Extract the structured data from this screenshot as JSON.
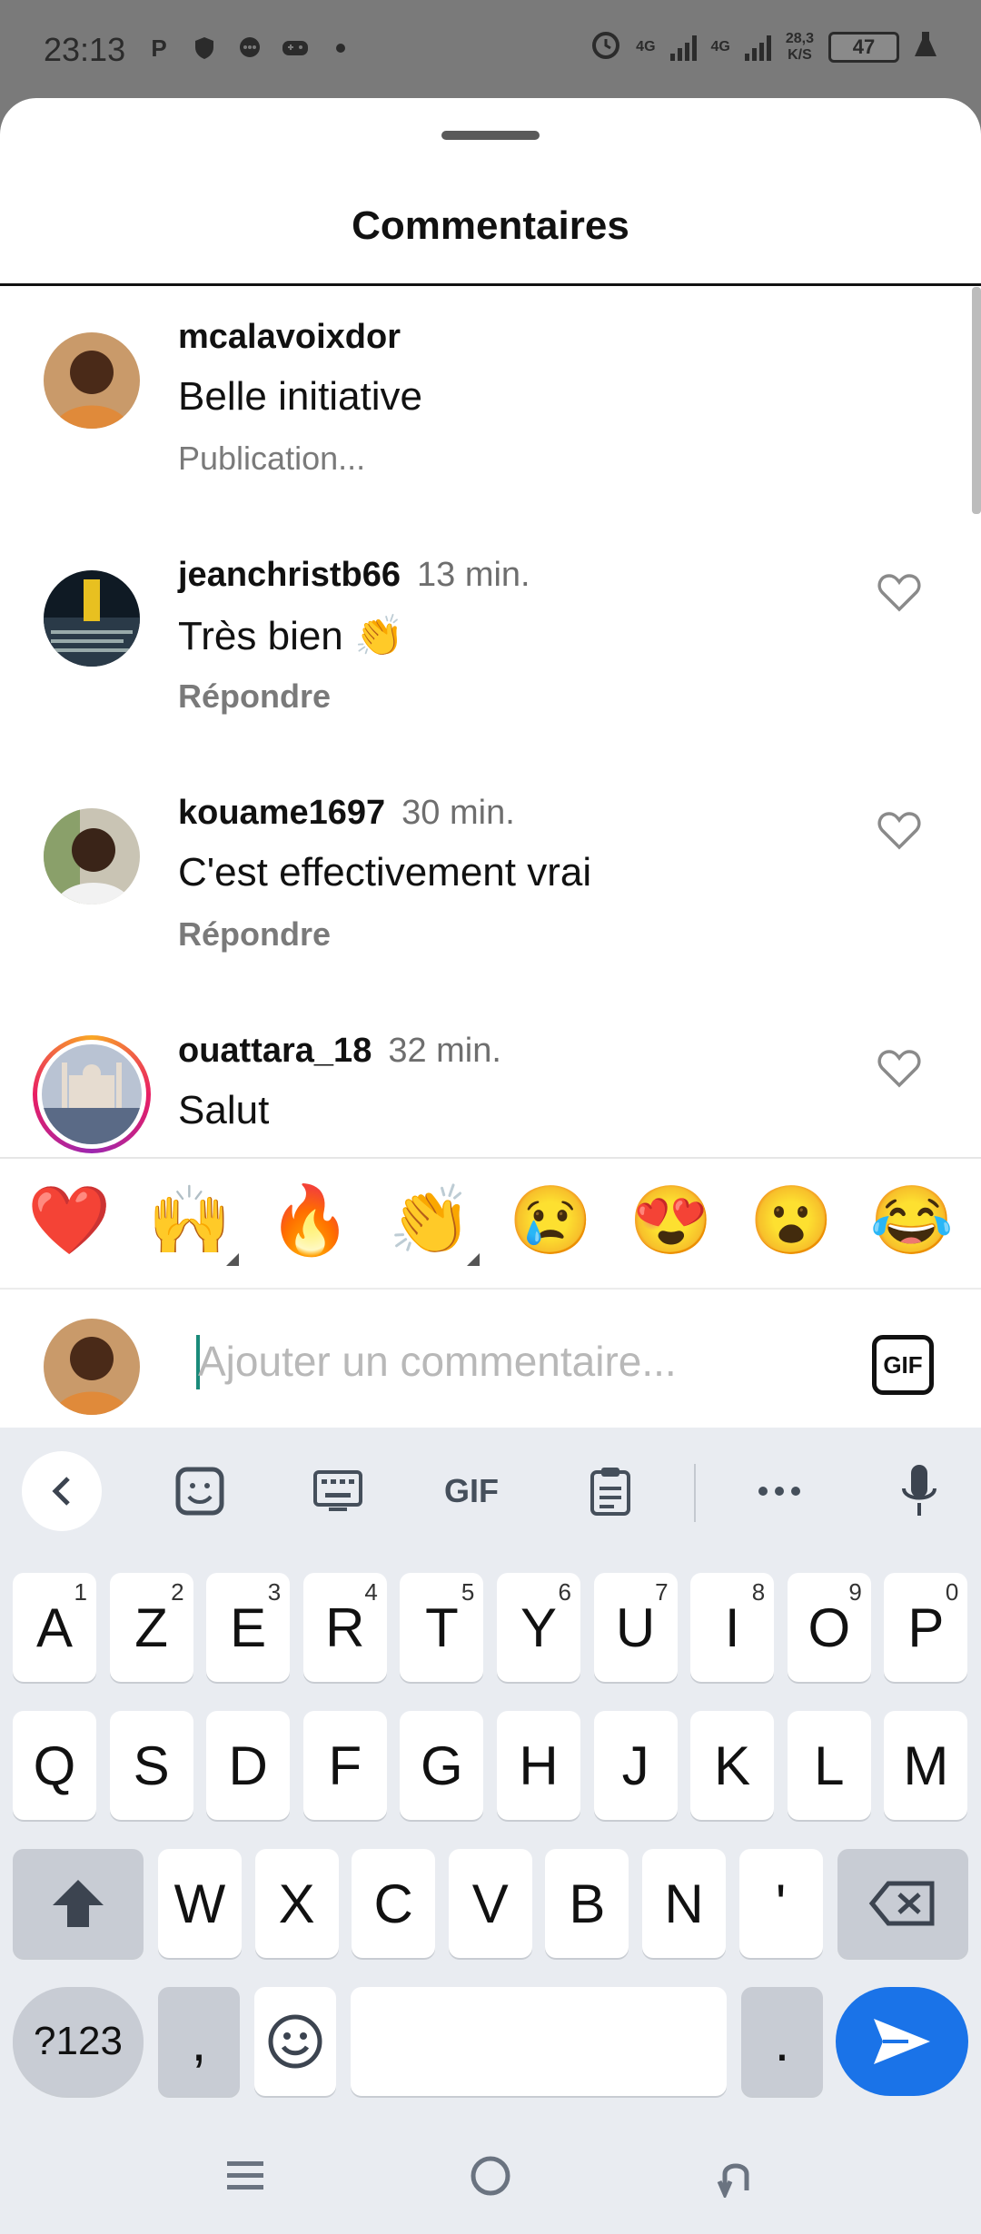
{
  "status_bar": {
    "time": "23:13",
    "left_icons": [
      "p-icon",
      "shield-icon",
      "chat-bubble-icon",
      "gamepad-icon",
      "dot-icon"
    ],
    "network_1": "4G",
    "network_2": "4G",
    "speed_value": "28,3",
    "speed_unit": "K/S",
    "battery": "47"
  },
  "sheet": {
    "title": "Commentaires"
  },
  "comments": [
    {
      "username": "mcalavoixdor",
      "time": "",
      "text": "Belle initiative",
      "meta": "Publication...",
      "liked": false,
      "has_heart": false
    },
    {
      "username": "jeanchristb66",
      "time": "13 min.",
      "text": "Très bien 👏",
      "meta": "Répondre",
      "has_heart": true
    },
    {
      "username": "kouame1697",
      "time": "30 min.",
      "text": "C'est effectivement vrai",
      "meta": "Répondre",
      "has_heart": true
    },
    {
      "username": "ouattara_18",
      "time": "32 min.",
      "text": "Salut",
      "meta": "",
      "has_heart": true
    }
  ],
  "quick_emojis": [
    "❤️",
    "🙌",
    "🔥",
    "👏",
    "😢",
    "😍",
    "😮",
    "😂"
  ],
  "input": {
    "placeholder": "Ajouter un commentaire...",
    "value": "",
    "gif_label": "GIF"
  },
  "keyboard": {
    "toolbar": {
      "gif_label": "GIF"
    },
    "row1": [
      {
        "key": "A",
        "hint": "1"
      },
      {
        "key": "Z",
        "hint": "2"
      },
      {
        "key": "E",
        "hint": "3"
      },
      {
        "key": "R",
        "hint": "4"
      },
      {
        "key": "T",
        "hint": "5"
      },
      {
        "key": "Y",
        "hint": "6"
      },
      {
        "key": "U",
        "hint": "7"
      },
      {
        "key": "I",
        "hint": "8"
      },
      {
        "key": "O",
        "hint": "9"
      },
      {
        "key": "P",
        "hint": "0"
      }
    ],
    "row2": [
      "Q",
      "S",
      "D",
      "F",
      "G",
      "H",
      "J",
      "K",
      "L",
      "M"
    ],
    "row3": [
      "W",
      "X",
      "C",
      "V",
      "B",
      "N",
      "'"
    ],
    "bottom": {
      "symbols": "?123",
      "comma": ",",
      "period": "."
    }
  },
  "colors": {
    "accent_send": "#1a73e8",
    "ring_start": "#f9a825",
    "ring_end": "#e91e63"
  }
}
